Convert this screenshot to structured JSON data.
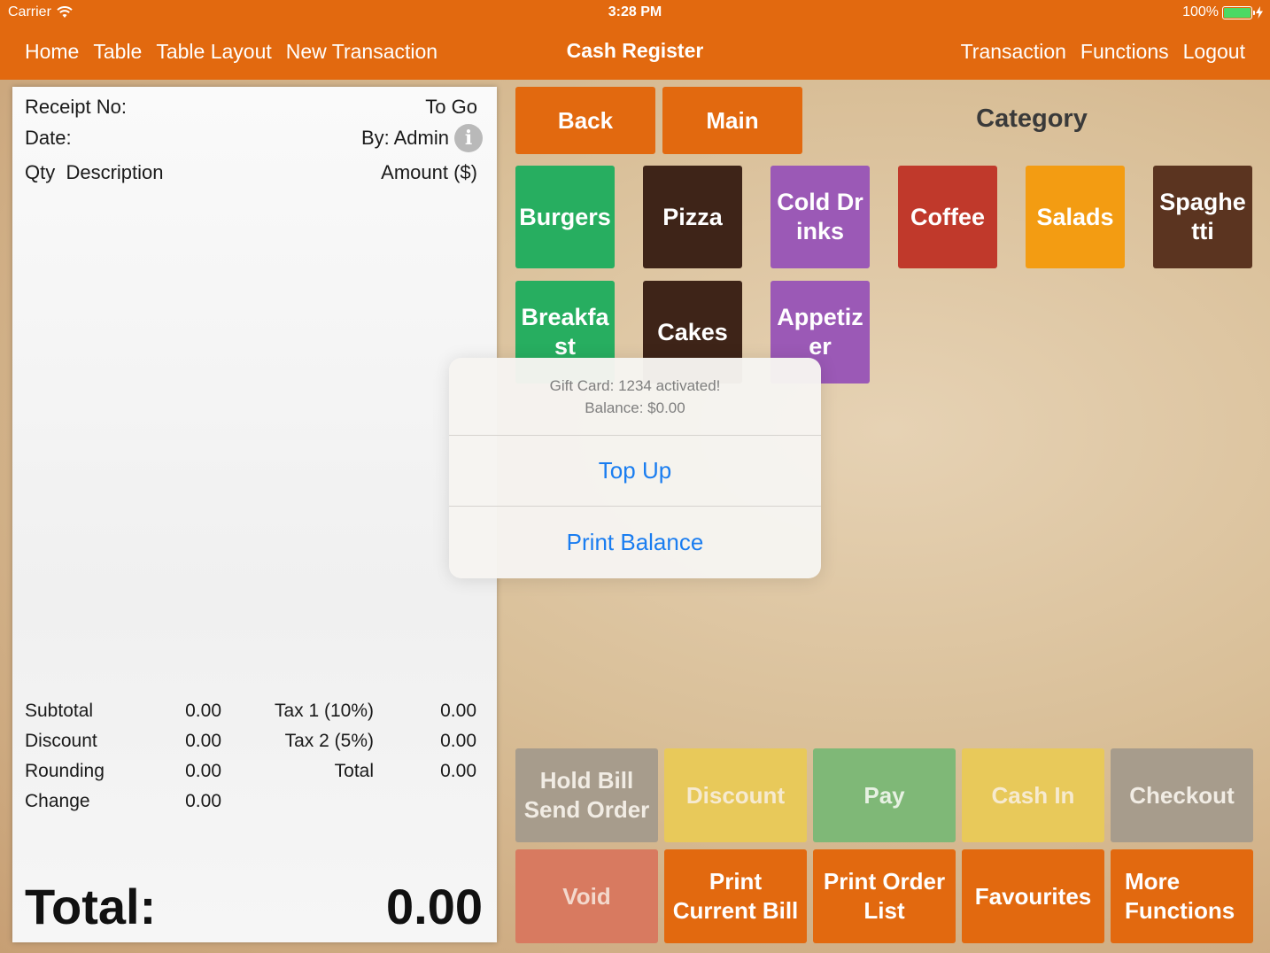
{
  "status_bar": {
    "carrier": "Carrier",
    "time": "3:28 PM",
    "battery": "100%",
    "battery_level": 1.0
  },
  "navbar": {
    "left_links": [
      "Home",
      "Table",
      "Table Layout",
      "New Transaction"
    ],
    "title": "Cash Register",
    "right_links": [
      "Transaction",
      "Functions",
      "Logout"
    ]
  },
  "receipt": {
    "receipt_no_label": "Receipt No:",
    "order_type": "To Go",
    "date_label": "Date:",
    "by_label": "By: Admin",
    "info_glyph": "i",
    "col_qty": "Qty",
    "col_desc": "Description",
    "col_amount": "Amount ($)",
    "subtotal_label": "Subtotal",
    "subtotal": "0.00",
    "discount_label": "Discount",
    "discount": "0.00",
    "rounding_label": "Rounding",
    "rounding": "0.00",
    "change_label": "Change",
    "change": "0.00",
    "tax1_label": "Tax 1 (10%)",
    "tax1": "0.00",
    "tax2_label": "Tax 2 (5%)",
    "tax2": "0.00",
    "total_label": "Total",
    "total": "0.00",
    "grand_total_label": "Total:",
    "grand_total": "0.00"
  },
  "nav_buttons": {
    "back": "Back",
    "main": "Main"
  },
  "category_heading": "Category",
  "categories": [
    {
      "label": "Burgers",
      "color": "#27ae60"
    },
    {
      "label": "Pizza",
      "color": "#3e2418"
    },
    {
      "label": "Cold Drinks",
      "color": "#9b59b6"
    },
    {
      "label": "Coffee",
      "color": "#c0392b"
    },
    {
      "label": "Salads",
      "color": "#f39c12"
    },
    {
      "label": "Spaghetti",
      "color": "#5b3420"
    },
    {
      "label": "Breakfast",
      "color": "#27ae60"
    },
    {
      "label": "Cakes",
      "color": "#3e2418"
    },
    {
      "label": "Appetizer",
      "color": "#9b59b6"
    }
  ],
  "actions": {
    "hold_bill_1": "Hold Bill",
    "hold_bill_2": "Send Order",
    "discount": "Discount",
    "pay": "Pay",
    "cash_in": "Cash In",
    "checkout": "Checkout",
    "void": "Void",
    "print_current_bill_1": "Print",
    "print_current_bill_2": "Current Bill",
    "print_order_list_1": "Print Order",
    "print_order_list_2": "List",
    "favourites": "Favourites",
    "more_functions_1": "More",
    "more_functions_2": "Functions"
  },
  "colors": {
    "accent": "#e2690f",
    "hold_bill": "#a79c8c",
    "discount": "#e8c95a",
    "pay": "#7fb877",
    "cash_in": "#e8c95a",
    "checkout": "#a79c8c",
    "void": "#d87a60"
  },
  "dialog": {
    "message_line1": "Gift Card: 1234 activated!",
    "message_line2": "Balance: $0.00",
    "top_up": "Top Up",
    "print_balance": "Print Balance"
  }
}
